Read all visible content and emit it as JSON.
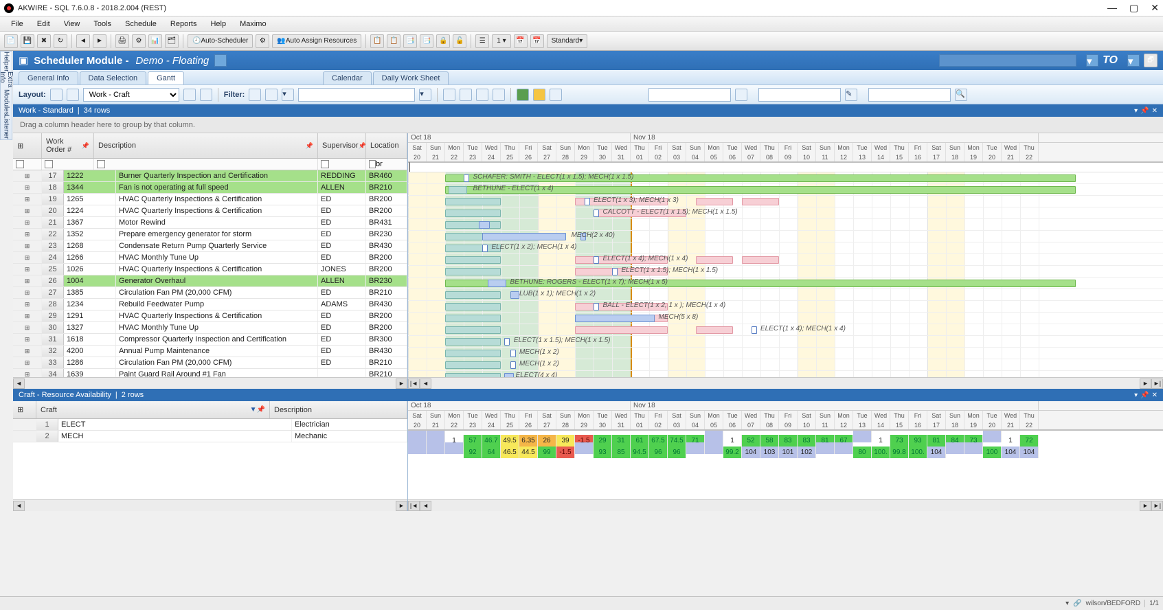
{
  "window": {
    "title": "AKWIRE - SQL 7.6.0.8 - 2018.2.004 (REST)"
  },
  "menubar": [
    "File",
    "Edit",
    "View",
    "Tools",
    "Schedule",
    "Reports",
    "Help",
    "Maximo"
  ],
  "toolbar": {
    "auto_scheduler": "Auto-Scheduler",
    "auto_assign": "Auto Assign Resources",
    "standard": "Standard"
  },
  "module": {
    "title1": "Scheduler Module -",
    "title2": "Demo - Floating",
    "to": "TO"
  },
  "tabs": {
    "general": "General Info",
    "data": "Data Selection",
    "gantt": "Gantt",
    "calendar": "Calendar",
    "daily": "Daily Work Sheet"
  },
  "layout": {
    "label": "Layout:",
    "value": "Work - Craft",
    "filter_label": "Filter:"
  },
  "sidetabs": [
    "Helper",
    "Extra Info",
    "Modules",
    "Listener"
  ],
  "panel1": {
    "title": "Work - Standard",
    "rows": "34 rows",
    "grouphint": "Drag a column header here to group by that column."
  },
  "gridheaders": {
    "wo": "Work Order #",
    "desc": "Description",
    "sup": "Supervisor",
    "loc": "Location"
  },
  "filter": {
    "loc": "br"
  },
  "rows": [
    {
      "n": "17",
      "wo": "1222",
      "desc": "Burner Quarterly Inspection and Certification",
      "sup": "REDDING",
      "loc": "BR460",
      "hl": true
    },
    {
      "n": "18",
      "wo": "1344",
      "desc": "Fan is not operating at full speed",
      "sup": "ALLEN",
      "loc": "BR210",
      "hl": true
    },
    {
      "n": "19",
      "wo": "1265",
      "desc": "HVAC Quarterly Inspections & Certification",
      "sup": "ED",
      "loc": "BR200"
    },
    {
      "n": "20",
      "wo": "1224",
      "desc": "HVAC Quarterly Inspections & Certification",
      "sup": "ED",
      "loc": "BR200"
    },
    {
      "n": "21",
      "wo": "1367",
      "desc": "Motor Rewind",
      "sup": "ED",
      "loc": "BR431"
    },
    {
      "n": "22",
      "wo": "1352",
      "desc": "Prepare emergency generator for storm",
      "sup": "ED",
      "loc": "BR230"
    },
    {
      "n": "23",
      "wo": "1268",
      "desc": "Condensate Return Pump Quarterly Service",
      "sup": "ED",
      "loc": "BR430"
    },
    {
      "n": "24",
      "wo": "1266",
      "desc": "HVAC Monthly Tune Up",
      "sup": "ED",
      "loc": "BR200"
    },
    {
      "n": "25",
      "wo": "1026",
      "desc": "HVAC Quarterly Inspections & Certification",
      "sup": "JONES",
      "loc": "BR200"
    },
    {
      "n": "26",
      "wo": "1004",
      "desc": "Generator Overhaul",
      "sup": "ALLEN",
      "loc": "BR230",
      "hl": true
    },
    {
      "n": "27",
      "wo": "1385",
      "desc": "Circulation Fan PM (20,000 CFM)",
      "sup": "ED",
      "loc": "BR210"
    },
    {
      "n": "28",
      "wo": "1234",
      "desc": "Rebuild Feedwater Pump",
      "sup": "ADAMS",
      "loc": "BR430"
    },
    {
      "n": "29",
      "wo": "1291",
      "desc": "HVAC Quarterly Inspections & Certification",
      "sup": "ED",
      "loc": "BR200"
    },
    {
      "n": "30",
      "wo": "1327",
      "desc": "HVAC Monthly Tune Up",
      "sup": "ED",
      "loc": "BR200"
    },
    {
      "n": "31",
      "wo": "1618",
      "desc": "Compressor Quarterly Inspection and Certification",
      "sup": "ED",
      "loc": "BR300"
    },
    {
      "n": "32",
      "wo": "4200",
      "desc": "Annual Pump Maintenance",
      "sup": "ED",
      "loc": "BR430"
    },
    {
      "n": "33",
      "wo": "1286",
      "desc": "Circulation Fan PM (20,000 CFM)",
      "sup": "ED",
      "loc": "BR210"
    },
    {
      "n": "34",
      "wo": "1639",
      "desc": "Paint Guard Rail Around #1 Fan",
      "sup": "",
      "loc": "BR210"
    }
  ],
  "timeline": {
    "months": [
      {
        "label": "Oct 18",
        "span": 12
      },
      {
        "label": "Nov 18",
        "span": 22
      }
    ],
    "days": [
      "Sat",
      "Sun",
      "Mon",
      "Tue",
      "Wed",
      "Thu",
      "Fri",
      "Sat",
      "Sun",
      "Mon",
      "Tue",
      "Wed",
      "Thu",
      "Fri",
      "Sat",
      "Sun",
      "Mon",
      "Tue",
      "Wed",
      "Thu",
      "Fri",
      "Sat",
      "Sun",
      "Mon",
      "Tue",
      "Wed",
      "Thu",
      "Fri",
      "Sat",
      "Sun",
      "Mon",
      "Tue",
      "Wed",
      "Thu"
    ],
    "nums": [
      "20",
      "21",
      "22",
      "23",
      "24",
      "25",
      "26",
      "27",
      "28",
      "29",
      "30",
      "31",
      "01",
      "02",
      "03",
      "04",
      "05",
      "06",
      "07",
      "08",
      "09",
      "10",
      "11",
      "12",
      "13",
      "14",
      "15",
      "16",
      "17",
      "18",
      "19",
      "20",
      "21",
      "22"
    ]
  },
  "bars_labels": {
    "r0": "SCHAFER: SMITH - ELECT(1 x 1.5); MECH(1 x 1.5)",
    "r1": "BETHUNE - ELECT(1 x 4)",
    "r2": "ELECT(1 x 3); MECH(1 x 3)",
    "r3": "CALCOTT - ELECT(1 x 1.5); MECH(1 x 1.5)",
    "r5": "MECH(2 x 40)",
    "r6": "ELECT(1 x 2); MECH(1 x 4)",
    "r7": "ELECT(1 x 4); MECH(1 x 4)",
    "r8": "ELECT(1 x 1.5); MECH(1 x 1.5)",
    "r9": "BETHUNE: ROGERS - ELECT(1 x 7); MECH(1 x 5)",
    "r10": "LUB(1 x 1); MECH(1 x 2)",
    "r11": "BALL - ELECT(1 x 2, 1 x ); MECH(1 x 4)",
    "r12": "MECH(5 x 8)",
    "r13": "ELECT(1 x 4); MECH(1 x 4)",
    "r14": "ELECT(1 x 1.5); MECH(1 x 1.5)",
    "r15": "MECH(1 x 2)",
    "r16": "MECH(1 x 2)",
    "r17": "ELECT(4 x 4)"
  },
  "panel2": {
    "title": "Craft - Resource Availability",
    "rows": "2 rows"
  },
  "craftheaders": {
    "craft": "Craft",
    "desc": "Description"
  },
  "crafts": [
    {
      "n": "1",
      "code": "ELECT",
      "desc": "Electrician"
    },
    {
      "n": "2",
      "code": "MECH",
      "desc": "Mechanic"
    }
  ],
  "craftcells": {
    "elect": [
      {
        "v": "",
        "c": "b"
      },
      {
        "v": "",
        "c": "b"
      },
      {
        "v": "1",
        "c": "w"
      },
      {
        "v": "57",
        "c": "g"
      },
      {
        "v": "46.7",
        "c": "g"
      },
      {
        "v": "49.5",
        "c": "y"
      },
      {
        "v": "6.35",
        "c": "o"
      },
      {
        "v": "26",
        "c": "o"
      },
      {
        "v": "39",
        "c": "y"
      },
      {
        "v": "-1.5",
        "c": "r"
      },
      {
        "v": "29",
        "c": "g"
      },
      {
        "v": "31",
        "c": "g"
      },
      {
        "v": "61",
        "c": "g"
      },
      {
        "v": "67.5",
        "c": "g"
      },
      {
        "v": "74.5",
        "c": "g"
      },
      {
        "v": "71",
        "c": "g"
      },
      {
        "v": "",
        "c": "b"
      },
      {
        "v": "1",
        "c": "w"
      },
      {
        "v": "52",
        "c": "g"
      },
      {
        "v": "58",
        "c": "g"
      },
      {
        "v": "83",
        "c": "g"
      },
      {
        "v": "83",
        "c": "g"
      },
      {
        "v": "81",
        "c": "g"
      },
      {
        "v": "67",
        "c": "g"
      },
      {
        "v": "",
        "c": "b"
      },
      {
        "v": "1",
        "c": "w"
      },
      {
        "v": "73",
        "c": "g"
      },
      {
        "v": "93",
        "c": "g"
      },
      {
        "v": "81",
        "c": "g"
      },
      {
        "v": "84",
        "c": "g"
      },
      {
        "v": "73",
        "c": "g"
      },
      {
        "v": "",
        "c": "b"
      },
      {
        "v": "1",
        "c": "w"
      },
      {
        "v": "72",
        "c": "g"
      }
    ],
    "mech": [
      {
        "v": "",
        "c": "b"
      },
      {
        "v": "",
        "c": "b"
      },
      {
        "v": "",
        "c": "b"
      },
      {
        "v": "92",
        "c": "g"
      },
      {
        "v": "64",
        "c": "g"
      },
      {
        "v": "46.5",
        "c": "y"
      },
      {
        "v": "44.5",
        "c": "y"
      },
      {
        "v": "99",
        "c": "g"
      },
      {
        "v": "-1.5",
        "c": "r"
      },
      {
        "v": "",
        "c": "b"
      },
      {
        "v": "93",
        "c": "g"
      },
      {
        "v": "85",
        "c": "g"
      },
      {
        "v": "94.5",
        "c": "g"
      },
      {
        "v": "96",
        "c": "g"
      },
      {
        "v": "96",
        "c": "g"
      },
      {
        "v": "",
        "c": "b"
      },
      {
        "v": "",
        "c": "b"
      },
      {
        "v": "99.2",
        "c": "g"
      },
      {
        "v": "104",
        "c": "b"
      },
      {
        "v": "103",
        "c": "b"
      },
      {
        "v": "101",
        "c": "b"
      },
      {
        "v": "102",
        "c": "b"
      },
      {
        "v": "",
        "c": "b"
      },
      {
        "v": "",
        "c": "b"
      },
      {
        "v": "80",
        "c": "g"
      },
      {
        "v": "100.",
        "c": "g"
      },
      {
        "v": "99.8",
        "c": "g"
      },
      {
        "v": "100.",
        "c": "g"
      },
      {
        "v": "104",
        "c": "b"
      },
      {
        "v": "",
        "c": "b"
      },
      {
        "v": "",
        "c": "b"
      },
      {
        "v": "100",
        "c": "g"
      },
      {
        "v": "104",
        "c": "b"
      },
      {
        "v": "104",
        "c": "b"
      }
    ]
  },
  "status": {
    "user": "wilson/BEDFORD",
    "page": "1/1"
  }
}
